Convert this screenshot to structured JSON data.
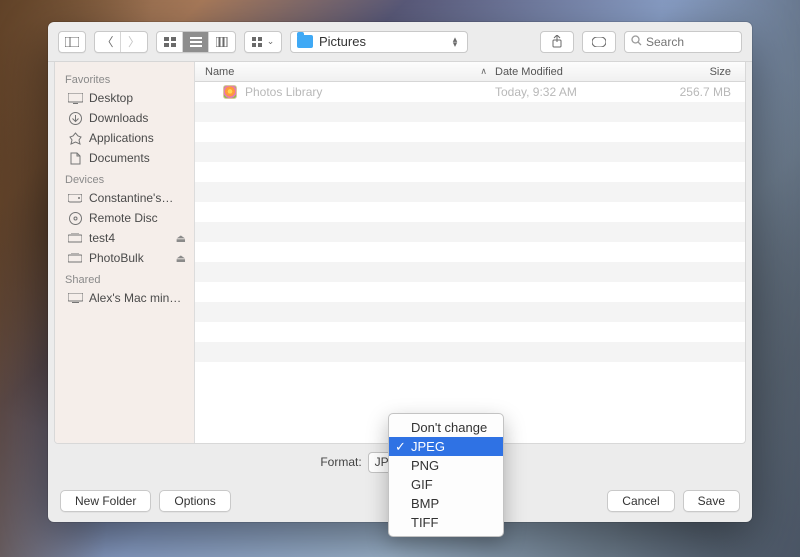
{
  "toolbar": {
    "path_label": "Pictures",
    "search_placeholder": "Search"
  },
  "sidebar": {
    "sections": [
      {
        "header": "Favorites",
        "items": [
          {
            "label": "Desktop",
            "icon": "desktop"
          },
          {
            "label": "Downloads",
            "icon": "downloads"
          },
          {
            "label": "Applications",
            "icon": "applications"
          },
          {
            "label": "Documents",
            "icon": "documents"
          }
        ]
      },
      {
        "header": "Devices",
        "items": [
          {
            "label": "Constantine's…",
            "icon": "drive"
          },
          {
            "label": "Remote Disc",
            "icon": "disc"
          },
          {
            "label": "test4",
            "icon": "ext-drive",
            "eject": true
          },
          {
            "label": "PhotoBulk",
            "icon": "ext-drive",
            "eject": true
          }
        ]
      },
      {
        "header": "Shared",
        "items": [
          {
            "label": "Alex's Mac min…",
            "icon": "network"
          }
        ]
      }
    ]
  },
  "columns": {
    "name": "Name",
    "modified": "Date Modified",
    "size": "Size"
  },
  "rows": [
    {
      "name": "Photos Library",
      "modified": "Today, 9:32 AM",
      "size": "256.7 MB"
    }
  ],
  "format": {
    "label": "Format:",
    "value": "JPEG",
    "options": [
      "Don't change",
      "JPEG",
      "PNG",
      "GIF",
      "BMP",
      "TIFF"
    ],
    "selectedIndex": 1
  },
  "buttons": {
    "new_folder": "New Folder",
    "options": "Options",
    "cancel": "Cancel",
    "save": "Save"
  }
}
